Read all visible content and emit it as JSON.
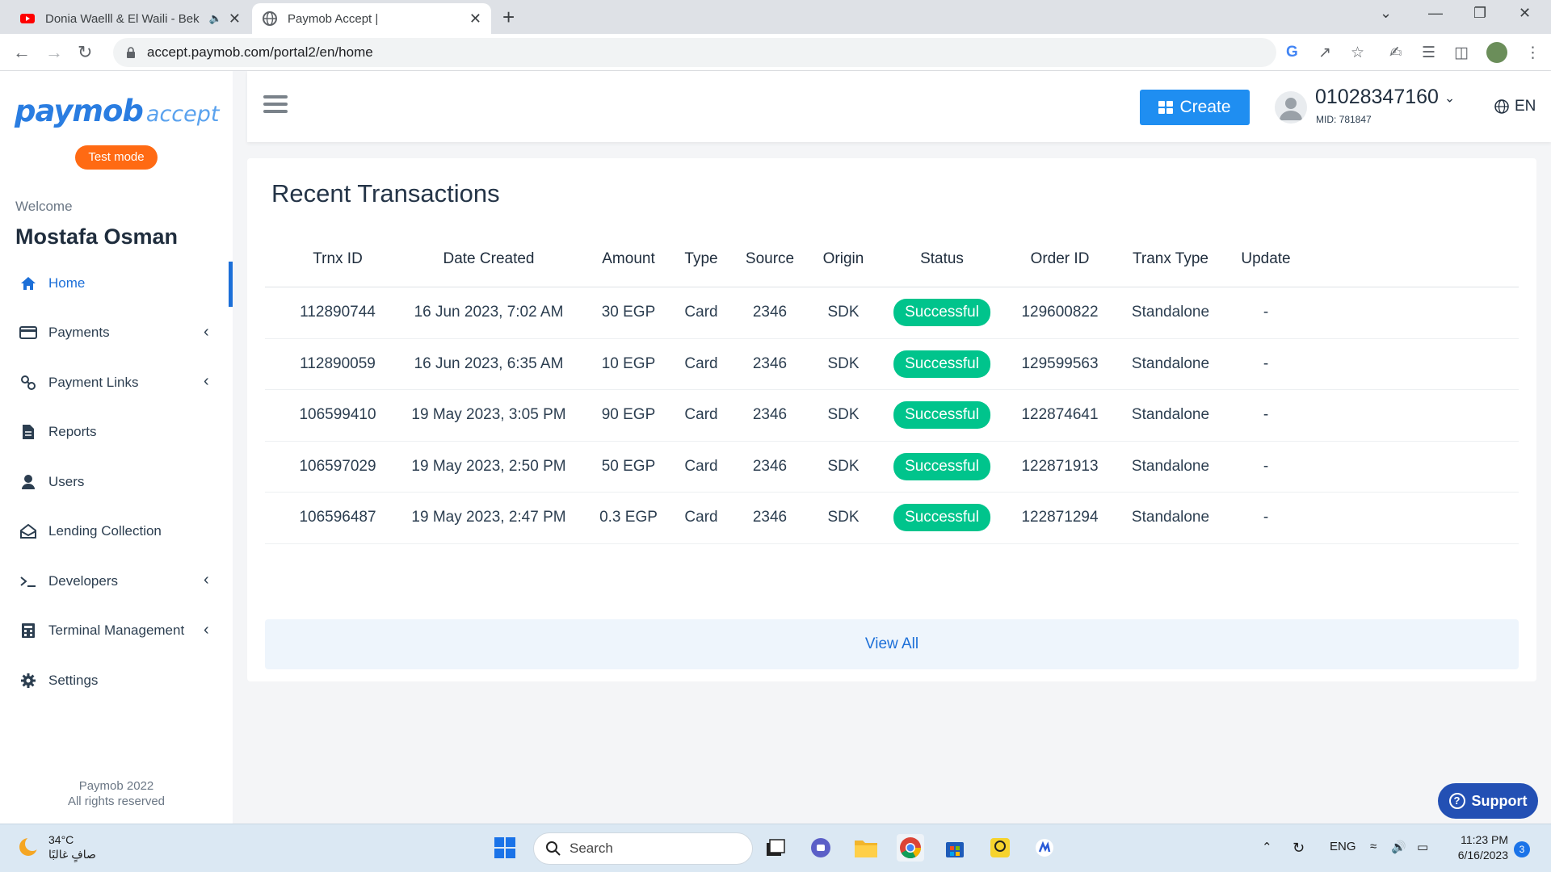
{
  "browser": {
    "tabs": [
      {
        "title": "Donia Waelll & El Waili - Bek",
        "icon": "youtube-icon"
      },
      {
        "title": "Paymob Accept |",
        "icon": "globe-icon"
      }
    ],
    "url": "accept.paymob.com/portal2/en/home"
  },
  "sidebar": {
    "logo_main": "paymob",
    "logo_sub": "accept",
    "test_mode": "Test mode",
    "welcome": "Welcome",
    "username": "Mostafa Osman",
    "items": [
      {
        "label": "Home",
        "icon": "home-icon",
        "active": true,
        "chevron": false
      },
      {
        "label": "Payments",
        "icon": "credit-card-icon",
        "chevron": true
      },
      {
        "label": "Payment Links",
        "icon": "link-icon",
        "chevron": true
      },
      {
        "label": "Reports",
        "icon": "document-icon",
        "chevron": false
      },
      {
        "label": "Users",
        "icon": "user-icon",
        "chevron": false
      },
      {
        "label": "Lending Collection",
        "icon": "inbox-icon",
        "chevron": false
      },
      {
        "label": "Developers",
        "icon": "terminal-icon",
        "chevron": true
      },
      {
        "label": "Terminal Management",
        "icon": "calculator-icon",
        "chevron": true
      },
      {
        "label": "Settings",
        "icon": "gear-icon",
        "chevron": false
      }
    ],
    "footer_line1": "Paymob 2022",
    "footer_line2": "All rights reserved"
  },
  "header": {
    "create_label": "Create",
    "account_phone": "01028347160",
    "mid": "MID: 781847",
    "language": "EN"
  },
  "transactions": {
    "title": "Recent Transactions",
    "columns": [
      "Trnx ID",
      "Date Created",
      "Amount",
      "Type",
      "Source",
      "Origin",
      "Status",
      "Order ID",
      "Tranx Type",
      "Update"
    ],
    "rows": [
      [
        "112890744",
        "16 Jun 2023, 7:02 AM",
        "30 EGP",
        "Card",
        "2346",
        "SDK",
        "Successful",
        "129600822",
        "Standalone",
        "-"
      ],
      [
        "112890059",
        "16 Jun 2023, 6:35 AM",
        "10 EGP",
        "Card",
        "2346",
        "SDK",
        "Successful",
        "129599563",
        "Standalone",
        "-"
      ],
      [
        "106599410",
        "19 May 2023, 3:05 PM",
        "90 EGP",
        "Card",
        "2346",
        "SDK",
        "Successful",
        "122874641",
        "Standalone",
        "-"
      ],
      [
        "106597029",
        "19 May 2023, 2:50 PM",
        "50 EGP",
        "Card",
        "2346",
        "SDK",
        "Successful",
        "122871913",
        "Standalone",
        "-"
      ],
      [
        "106596487",
        "19 May 2023, 2:47 PM",
        "0.3 EGP",
        "Card",
        "2346",
        "SDK",
        "Successful",
        "122871294",
        "Standalone",
        "-"
      ]
    ],
    "view_all": "View All"
  },
  "support_label": "Support",
  "taskbar": {
    "temperature": "34°C",
    "weather_text": "صافٍ غالبًا",
    "search_placeholder": "Search",
    "language": "ENG",
    "time": "11:23 PM",
    "date": "6/16/2023",
    "notification_count": "3"
  },
  "colors": {
    "brand_blue": "#1f8ef1",
    "active_nav": "#1c6fd8",
    "success_green": "#00c48c",
    "test_mode_orange": "#ff6a13",
    "support_blue": "#2350b4"
  }
}
